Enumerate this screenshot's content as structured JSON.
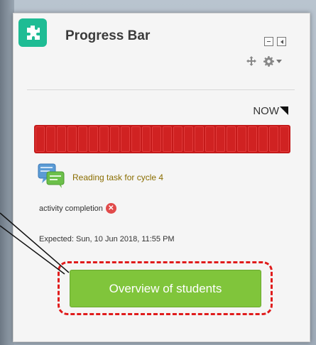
{
  "block": {
    "title": "Progress Bar",
    "now_label": "NOW",
    "progress": {
      "segments": 24,
      "completed_segments": 0,
      "segment_color": "#d02222"
    },
    "activity": {
      "name": "Reading task for cycle 4",
      "completion_text": "activity completion",
      "expected_text": "Expected: Sun, 10 Jun 2018, 11:55 PM"
    },
    "overview_button_label": "Overview of students"
  },
  "colors": {
    "logo": "#1ebc94",
    "button": "#80c53b",
    "highlight": "#e01c1c",
    "link": "#8a6d00"
  },
  "icons": [
    "puzzle-piece-icon",
    "minimize-icon",
    "dock-icon",
    "move-icon",
    "gear-icon",
    "chevron-down-icon",
    "chat-icon",
    "incomplete-icon"
  ]
}
